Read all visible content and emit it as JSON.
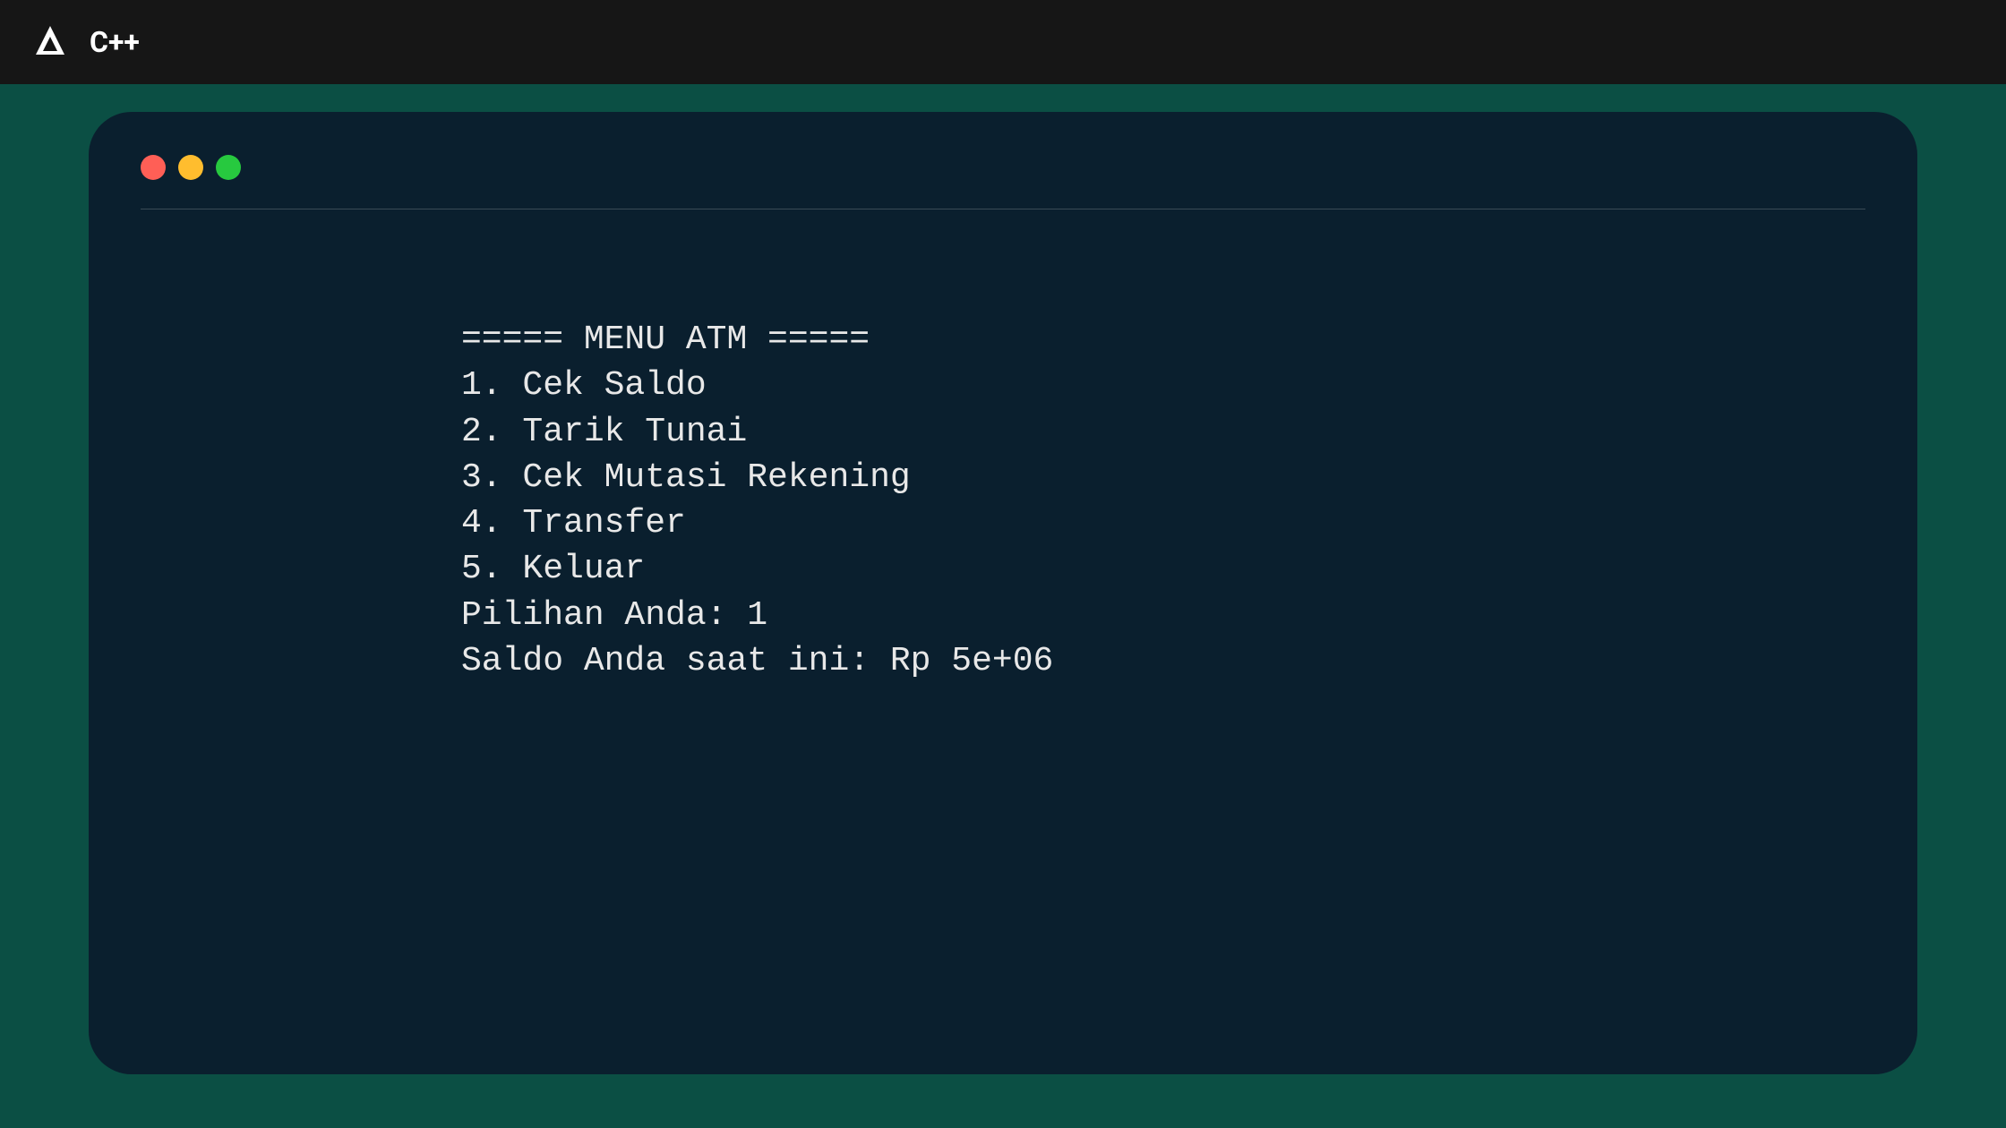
{
  "header": {
    "title": "C++"
  },
  "terminal": {
    "lines": [
      "===== MENU ATM =====",
      "1. Cek Saldo",
      "2. Tarik Tunai",
      "3. Cek Mutasi Rekening",
      "4. Transfer",
      "5. Keluar",
      "Pilihan Anda: 1",
      "Saldo Anda saat ini: Rp 5e+06"
    ]
  }
}
